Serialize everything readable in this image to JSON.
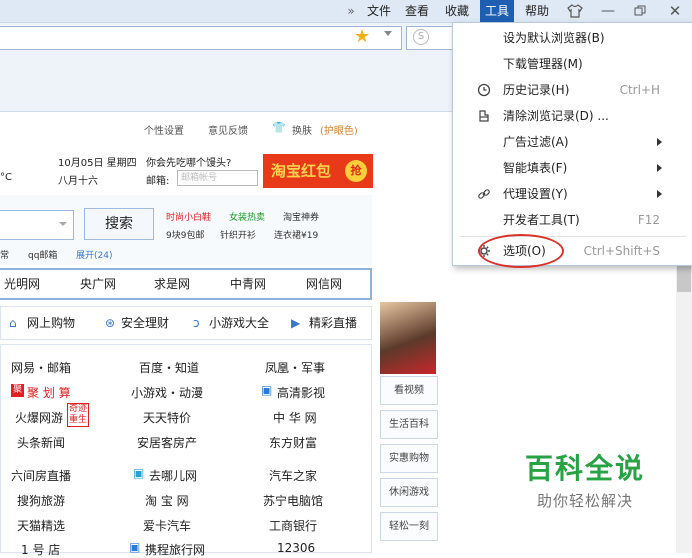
{
  "menubar": {
    "items": [
      {
        "label": "文件"
      },
      {
        "label": "查看"
      },
      {
        "label": "收藏"
      },
      {
        "label": "工具"
      },
      {
        "label": "帮助"
      }
    ],
    "chevron": "»"
  },
  "dropdown": {
    "items": [
      {
        "label": "设为默认浏览器(B)",
        "shortcut": ""
      },
      {
        "label": "下载管理器(M)",
        "shortcut": ""
      },
      {
        "label": "历史记录(H)",
        "shortcut": "Ctrl+H"
      },
      {
        "label": "清除浏览记录(D) ...",
        "shortcut": ""
      },
      {
        "label": "广告过滤(A)",
        "shortcut": ""
      },
      {
        "label": "智能填表(F)",
        "shortcut": ""
      },
      {
        "label": "代理设置(Y)",
        "shortcut": ""
      },
      {
        "label": "开发者工具(T)",
        "shortcut": "F12"
      },
      {
        "label": "选项(O)",
        "shortcut": "Ctrl+Shift+S"
      }
    ]
  },
  "page": {
    "toplinks": [
      "个性设置",
      "意见反馈",
      "换肤",
      "(护眼色)"
    ],
    "temp": "°C",
    "date": "10月05日 星期四",
    "lunar": "八月十六",
    "question": "你会先吃哪个馒头?",
    "mail_label": "邮箱:",
    "mail_placeholder": "邮箱帐号",
    "hongbao": "淘宝红包",
    "hongbao_tag": "抢",
    "search_button": "搜索",
    "hot1": [
      "时尚小白鞋",
      "女装热卖",
      "淘宝神券"
    ],
    "hot2": [
      "9块9包邮",
      "针织开衫",
      "连衣裙¥19"
    ],
    "quick": [
      "常",
      "qq邮箱",
      "展开(24)"
    ],
    "nav": [
      "光明网",
      "央广网",
      "求是网",
      "中青网",
      "网信网"
    ],
    "cats": [
      "网上购物",
      "安全理财",
      "小游戏大全",
      "精彩直播"
    ],
    "links": [
      [
        "网易・邮箱",
        "百度・知道",
        "凤凰・军事"
      ],
      [
        "聚 划 算",
        "小游戏・动漫",
        "高清影视"
      ],
      [
        "火爆网游",
        "天天特价",
        "中 华 网"
      ],
      [
        "头条新闻",
        "安居客房产",
        "东方财富"
      ],
      [
        "六间房直播",
        "去哪儿网",
        "汽车之家"
      ],
      [
        "搜狗旅游",
        "淘 宝 网",
        "苏宁电脑馆"
      ],
      [
        "天猫精选",
        "爱卡汽车",
        "工商银行"
      ],
      [
        "1 号 店",
        "携程旅行网",
        "12306"
      ]
    ],
    "badge": [
      "奇迹",
      "重生"
    ],
    "side": [
      "看视频",
      "生活百科",
      "实惠购物",
      "休闲游戏",
      "轻松一刻"
    ]
  },
  "watermark": {
    "title": "百科全说",
    "subtitle": "助你轻松解决"
  },
  "colors": {
    "accent": "#1e5fb4",
    "highlight_circle": "#d9322a",
    "watermark_green": "#27a343"
  }
}
